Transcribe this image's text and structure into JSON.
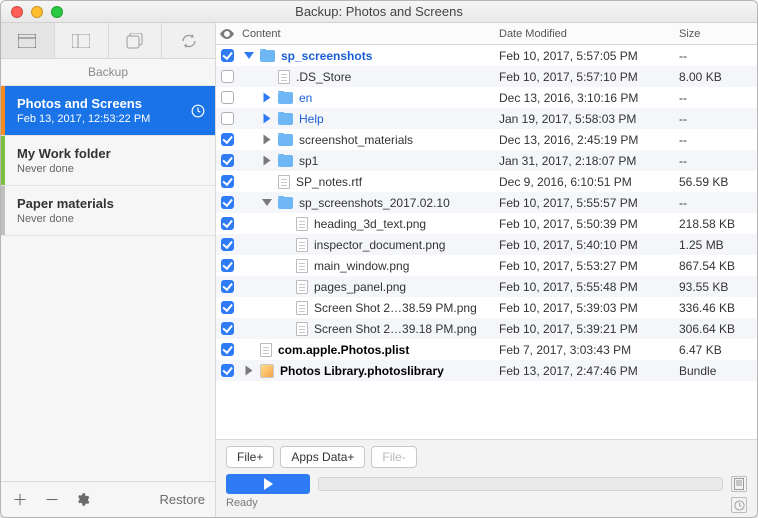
{
  "window_title": "Backup: Photos and Screens",
  "sidebar": {
    "header": "Backup",
    "items": [
      {
        "name": "Photos and Screens",
        "sub": "Feb 13, 2017, 12:53:22 PM",
        "accent": "#f58a1f",
        "selected": true
      },
      {
        "name": "My Work folder",
        "sub": "Never done",
        "accent": "#7bc043",
        "selected": false
      },
      {
        "name": "Paper materials",
        "sub": "Never done",
        "accent": "#bfbfbf",
        "selected": false
      }
    ],
    "restore_label": "Restore"
  },
  "columns": {
    "content": "Content",
    "date": "Date Modified",
    "size": "Size"
  },
  "rows": [
    {
      "checked": true,
      "indent": 0,
      "disc": "down",
      "icon": "folder",
      "label": "sp_screenshots",
      "link": true,
      "bold": true,
      "date": "Feb 10, 2017, 5:57:05 PM",
      "size": "--"
    },
    {
      "checked": false,
      "indent": 1,
      "disc": "",
      "icon": "file",
      "label": ".DS_Store",
      "date": "Feb 10, 2017, 5:57:10 PM",
      "size": "8.00 KB"
    },
    {
      "checked": false,
      "indent": 1,
      "disc": "right",
      "icon": "folder",
      "label": "en",
      "link": true,
      "date": "Dec 13, 2016, 3:10:16 PM",
      "size": "--"
    },
    {
      "checked": false,
      "indent": 1,
      "disc": "right",
      "icon": "folder",
      "label": "Help",
      "link": true,
      "date": "Jan 19, 2017, 5:58:03 PM",
      "size": "--"
    },
    {
      "checked": true,
      "indent": 1,
      "disc": "right",
      "icon": "folder",
      "label": "screenshot_materials",
      "date": "Dec 13, 2016, 2:45:19 PM",
      "size": "--"
    },
    {
      "checked": true,
      "indent": 1,
      "disc": "right",
      "icon": "folder",
      "label": "sp1",
      "date": "Jan 31, 2017, 2:18:07 PM",
      "size": "--"
    },
    {
      "checked": true,
      "indent": 1,
      "disc": "",
      "icon": "file",
      "label": "SP_notes.rtf",
      "date": "Dec 9, 2016, 6:10:51 PM",
      "size": "56.59 KB"
    },
    {
      "checked": true,
      "indent": 1,
      "disc": "down",
      "icon": "folder",
      "label": "sp_screenshots_2017.02.10",
      "date": "Feb 10, 2017, 5:55:57 PM",
      "size": "--"
    },
    {
      "checked": true,
      "indent": 2,
      "disc": "",
      "icon": "file",
      "label": "heading_3d_text.png",
      "date": "Feb 10, 2017, 5:50:39 PM",
      "size": "218.58 KB"
    },
    {
      "checked": true,
      "indent": 2,
      "disc": "",
      "icon": "file",
      "label": "inspector_document.png",
      "date": "Feb 10, 2017, 5:40:10 PM",
      "size": "1.25 MB"
    },
    {
      "checked": true,
      "indent": 2,
      "disc": "",
      "icon": "file",
      "label": "main_window.png",
      "date": "Feb 10, 2017, 5:53:27 PM",
      "size": "867.54 KB"
    },
    {
      "checked": true,
      "indent": 2,
      "disc": "",
      "icon": "file",
      "label": "pages_panel.png",
      "date": "Feb 10, 2017, 5:55:48 PM",
      "size": "93.55 KB"
    },
    {
      "checked": true,
      "indent": 2,
      "disc": "",
      "icon": "file",
      "label": "Screen Shot 2…38.59 PM.png",
      "date": "Feb 10, 2017, 5:39:03 PM",
      "size": "336.46 KB"
    },
    {
      "checked": true,
      "indent": 2,
      "disc": "",
      "icon": "file",
      "label": "Screen Shot 2…39.18 PM.png",
      "date": "Feb 10, 2017, 5:39:21 PM",
      "size": "306.64 KB"
    },
    {
      "checked": true,
      "indent": 0,
      "disc": "",
      "icon": "file",
      "label": "com.apple.Photos.plist",
      "bold": true,
      "date": "Feb 7, 2017, 3:03:43 PM",
      "size": "6.47 KB"
    },
    {
      "checked": true,
      "indent": 0,
      "disc": "right",
      "icon": "photo",
      "label": "Photos Library.photoslibrary",
      "bold": true,
      "date": "Feb 13, 2017, 2:47:46 PM",
      "size": "Bundle"
    }
  ],
  "footer": {
    "btn_file_plus": "File+",
    "btn_apps_data": "Apps Data+",
    "btn_file_minus": "File-",
    "status": "Ready"
  }
}
